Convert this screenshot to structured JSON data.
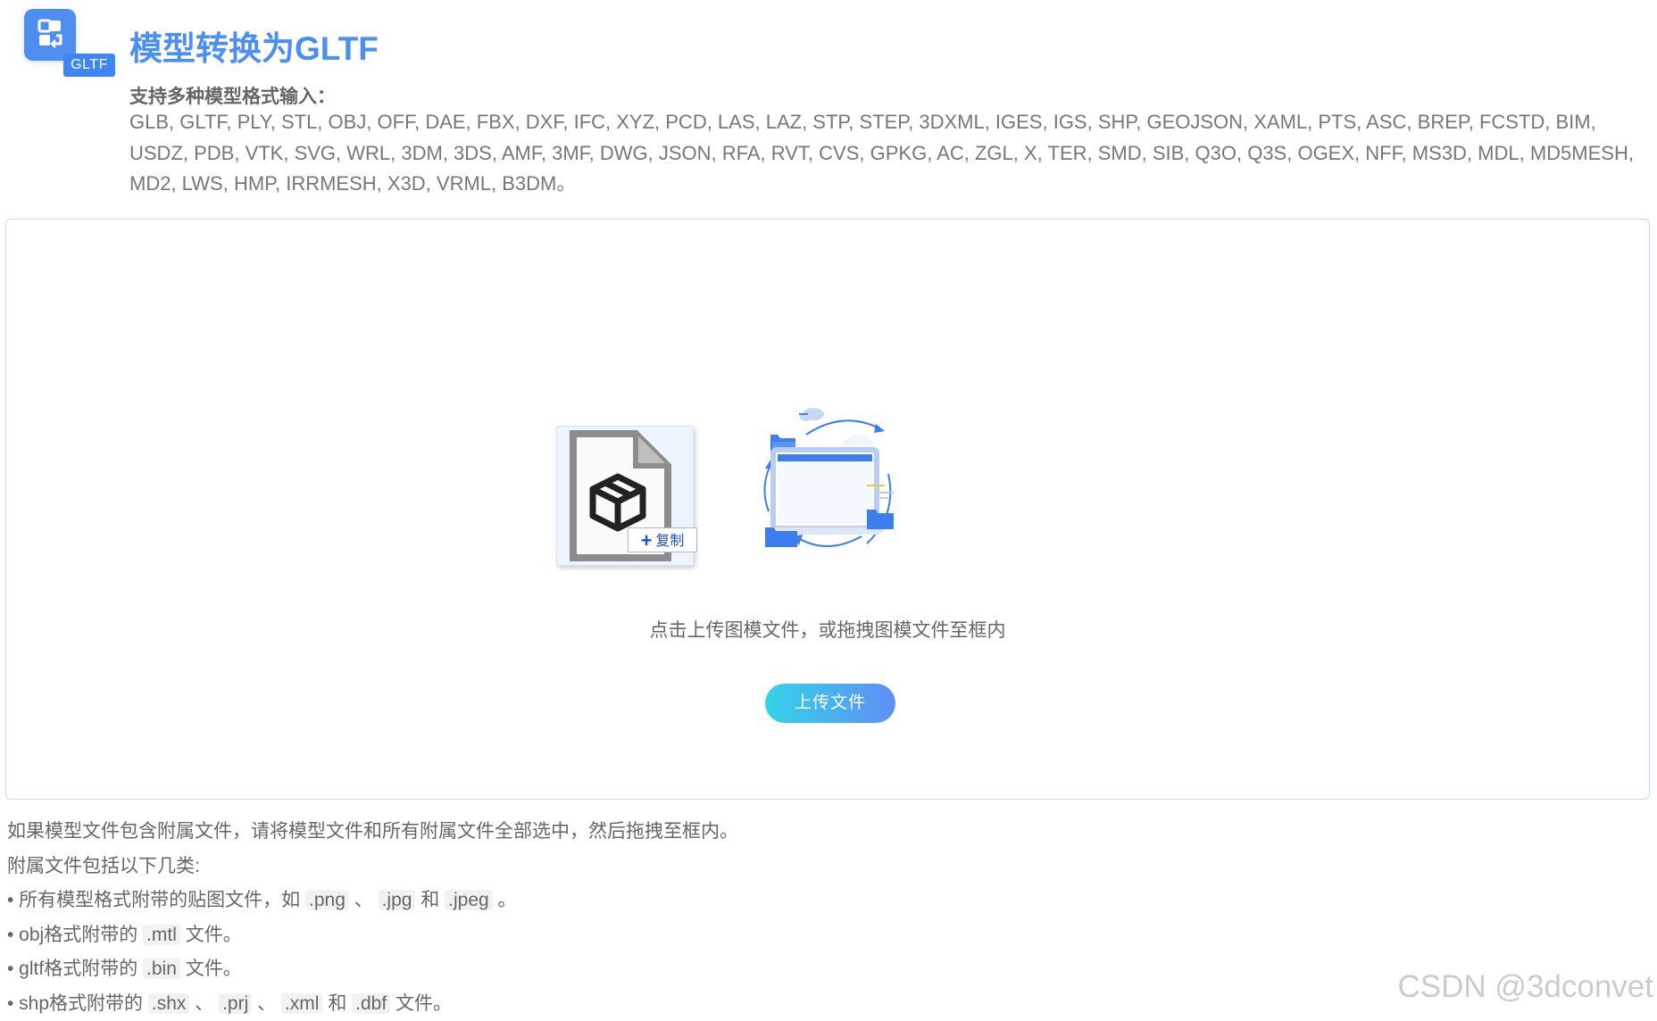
{
  "header": {
    "logo_tag": "GLTF",
    "title": "模型转换为GLTF",
    "subtitle": "支持多种模型格式输入：",
    "formats": "GLB, GLTF, PLY, STL, OBJ, OFF, DAE, FBX, DXF, IFC, XYZ, PCD, LAS, LAZ, STP, STEP, 3DXML, IGES, IGS, SHP, GEOJSON, XAML, PTS, ASC, BREP, FCSTD, BIM, USDZ, PDB, VTK, SVG, WRL, 3DM, 3DS, AMF, 3MF, DWG, JSON, RFA, RVT, CVS, GPKG, AC, ZGL, X, TER, SMD, SIB, Q3O, Q3S, OGEX, NFF, MS3D, MDL, MD5MESH, MD2, LWS, HMP, IRRMESH, X3D, VRML, B3DM。"
  },
  "dropzone": {
    "copy_badge": "复制",
    "hint": "点击上传图模文件，或拖拽图模文件至框内",
    "upload_button": "上传文件"
  },
  "notes": {
    "line1": "如果模型文件包含附属文件，请将模型文件和所有附属文件全部选中，然后拖拽至框内。",
    "line2": "附属文件包括以下几类:",
    "line3": {
      "prefix": "• 所有模型格式附带的贴图文件，如",
      "ext1": ".png",
      "sep1": "、",
      "ext2": ".jpg",
      "and": "和",
      "ext3": ".jpeg",
      "suffix": "。"
    },
    "line4": {
      "prefix": "• obj格式附带的",
      "ext1": ".mtl",
      "suffix": "文件。"
    },
    "line5": {
      "prefix": "• gltf格式附带的",
      "ext1": ".bin",
      "suffix": "文件。"
    },
    "line6": {
      "prefix": "• shp格式附带的",
      "ext1": ".shx",
      "sep1": "、",
      "ext2": ".prj",
      "sep2": "、",
      "ext3": ".xml",
      "and": "和",
      "ext4": ".dbf",
      "suffix": "文件。"
    }
  },
  "watermark": "CSDN @3dconvet",
  "colors": {
    "title": "#4b8ff5",
    "button_gradient_start": "#34d3e8",
    "button_gradient_end": "#5f8ff5",
    "dropzone_border": "#c9d9f2"
  }
}
